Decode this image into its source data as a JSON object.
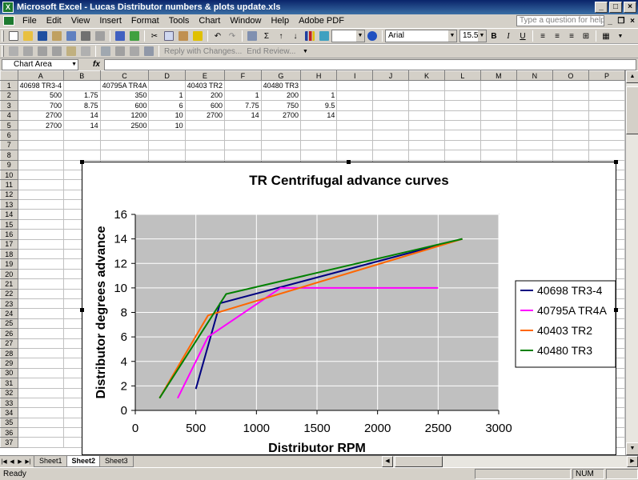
{
  "window": {
    "title": "Microsoft Excel - Lucas Distributor numbers & plots update.xls",
    "app_icon": "excel-icon",
    "controls": [
      "_",
      "□",
      "×"
    ]
  },
  "menu": {
    "items": [
      "File",
      "Edit",
      "View",
      "Insert",
      "Format",
      "Tools",
      "Chart",
      "Window",
      "Help",
      "Adobe PDF"
    ],
    "help_placeholder": "Type a question for help",
    "doc_controls": [
      "_",
      "❐",
      "×"
    ]
  },
  "toolbar": {
    "zoom_value": "",
    "font_name": "Arial",
    "font_size": "15.5",
    "bold": "B",
    "italic": "I",
    "underline": "U",
    "sigma": "Σ",
    "reply_changes": "Reply with Changes...",
    "end_review": "End Review..."
  },
  "formula_bar": {
    "name_box": "Chart Area",
    "fx": "fx",
    "value": ""
  },
  "sheet": {
    "columns": [
      "A",
      "B",
      "C",
      "D",
      "E",
      "F",
      "G",
      "H",
      "I",
      "J",
      "K",
      "L",
      "M",
      "N",
      "O",
      "P"
    ],
    "row_count": 37,
    "cells": [
      {
        "row": 1,
        "col": "A",
        "value": "40698 TR3-4",
        "type": "txt"
      },
      {
        "row": 1,
        "col": "C",
        "value": "40795A TR4A",
        "type": "txt"
      },
      {
        "row": 1,
        "col": "E",
        "value": "40403 TR2",
        "type": "txt"
      },
      {
        "row": 1,
        "col": "G",
        "value": "40480 TR3",
        "type": "txt"
      },
      {
        "row": 2,
        "col": "A",
        "value": "500",
        "type": "num"
      },
      {
        "row": 2,
        "col": "B",
        "value": "1.75",
        "type": "num"
      },
      {
        "row": 2,
        "col": "C",
        "value": "350",
        "type": "num"
      },
      {
        "row": 2,
        "col": "D",
        "value": "1",
        "type": "num"
      },
      {
        "row": 2,
        "col": "E",
        "value": "200",
        "type": "num"
      },
      {
        "row": 2,
        "col": "F",
        "value": "1",
        "type": "num"
      },
      {
        "row": 2,
        "col": "G",
        "value": "200",
        "type": "num"
      },
      {
        "row": 2,
        "col": "H",
        "value": "1",
        "type": "num"
      },
      {
        "row": 3,
        "col": "A",
        "value": "700",
        "type": "num"
      },
      {
        "row": 3,
        "col": "B",
        "value": "8.75",
        "type": "num"
      },
      {
        "row": 3,
        "col": "C",
        "value": "600",
        "type": "num"
      },
      {
        "row": 3,
        "col": "D",
        "value": "6",
        "type": "num"
      },
      {
        "row": 3,
        "col": "E",
        "value": "600",
        "type": "num"
      },
      {
        "row": 3,
        "col": "F",
        "value": "7.75",
        "type": "num"
      },
      {
        "row": 3,
        "col": "G",
        "value": "750",
        "type": "num"
      },
      {
        "row": 3,
        "col": "H",
        "value": "9.5",
        "type": "num"
      },
      {
        "row": 4,
        "col": "A",
        "value": "2700",
        "type": "num"
      },
      {
        "row": 4,
        "col": "B",
        "value": "14",
        "type": "num"
      },
      {
        "row": 4,
        "col": "C",
        "value": "1200",
        "type": "num"
      },
      {
        "row": 4,
        "col": "D",
        "value": "10",
        "type": "num"
      },
      {
        "row": 4,
        "col": "E",
        "value": "2700",
        "type": "num"
      },
      {
        "row": 4,
        "col": "F",
        "value": "14",
        "type": "num"
      },
      {
        "row": 4,
        "col": "G",
        "value": "2700",
        "type": "num"
      },
      {
        "row": 4,
        "col": "H",
        "value": "14",
        "type": "num"
      },
      {
        "row": 5,
        "col": "A",
        "value": "2700",
        "type": "num"
      },
      {
        "row": 5,
        "col": "B",
        "value": "14",
        "type": "num"
      },
      {
        "row": 5,
        "col": "C",
        "value": "2500",
        "type": "num"
      },
      {
        "row": 5,
        "col": "D",
        "value": "10",
        "type": "num"
      }
    ]
  },
  "tabs": {
    "sheets": [
      "Sheet1",
      "Sheet2",
      "Sheet3"
    ],
    "active": "Sheet2"
  },
  "status": {
    "text": "Ready",
    "num": "NUM"
  },
  "chart_data": {
    "type": "line",
    "title": "TR Centrifugal advance curves",
    "xlabel": "Distributor RPM",
    "ylabel": "Distributor degrees advance",
    "xlim": [
      0,
      3000
    ],
    "ylim": [
      0,
      16
    ],
    "xticks": [
      0,
      500,
      1000,
      1500,
      2000,
      2500,
      3000
    ],
    "yticks": [
      0,
      2,
      4,
      6,
      8,
      10,
      12,
      14,
      16
    ],
    "grid": true,
    "plot_background": "#c0c0c0",
    "legend_position": "right",
    "series": [
      {
        "name": "40698 TR3-4",
        "color": "#000080",
        "points": [
          [
            500,
            1.75
          ],
          [
            700,
            8.75
          ],
          [
            2700,
            14
          ],
          [
            2700,
            14
          ]
        ]
      },
      {
        "name": "40795A TR4A",
        "color": "#ff00ff",
        "points": [
          [
            350,
            1
          ],
          [
            600,
            6
          ],
          [
            1200,
            10
          ],
          [
            2500,
            10
          ]
        ]
      },
      {
        "name": "40403 TR2",
        "color": "#ff6600",
        "points": [
          [
            200,
            1
          ],
          [
            600,
            7.75
          ],
          [
            2700,
            14
          ]
        ]
      },
      {
        "name": "40480 TR3",
        "color": "#008000",
        "points": [
          [
            200,
            1
          ],
          [
            750,
            9.5
          ],
          [
            2700,
            14
          ]
        ]
      }
    ]
  }
}
